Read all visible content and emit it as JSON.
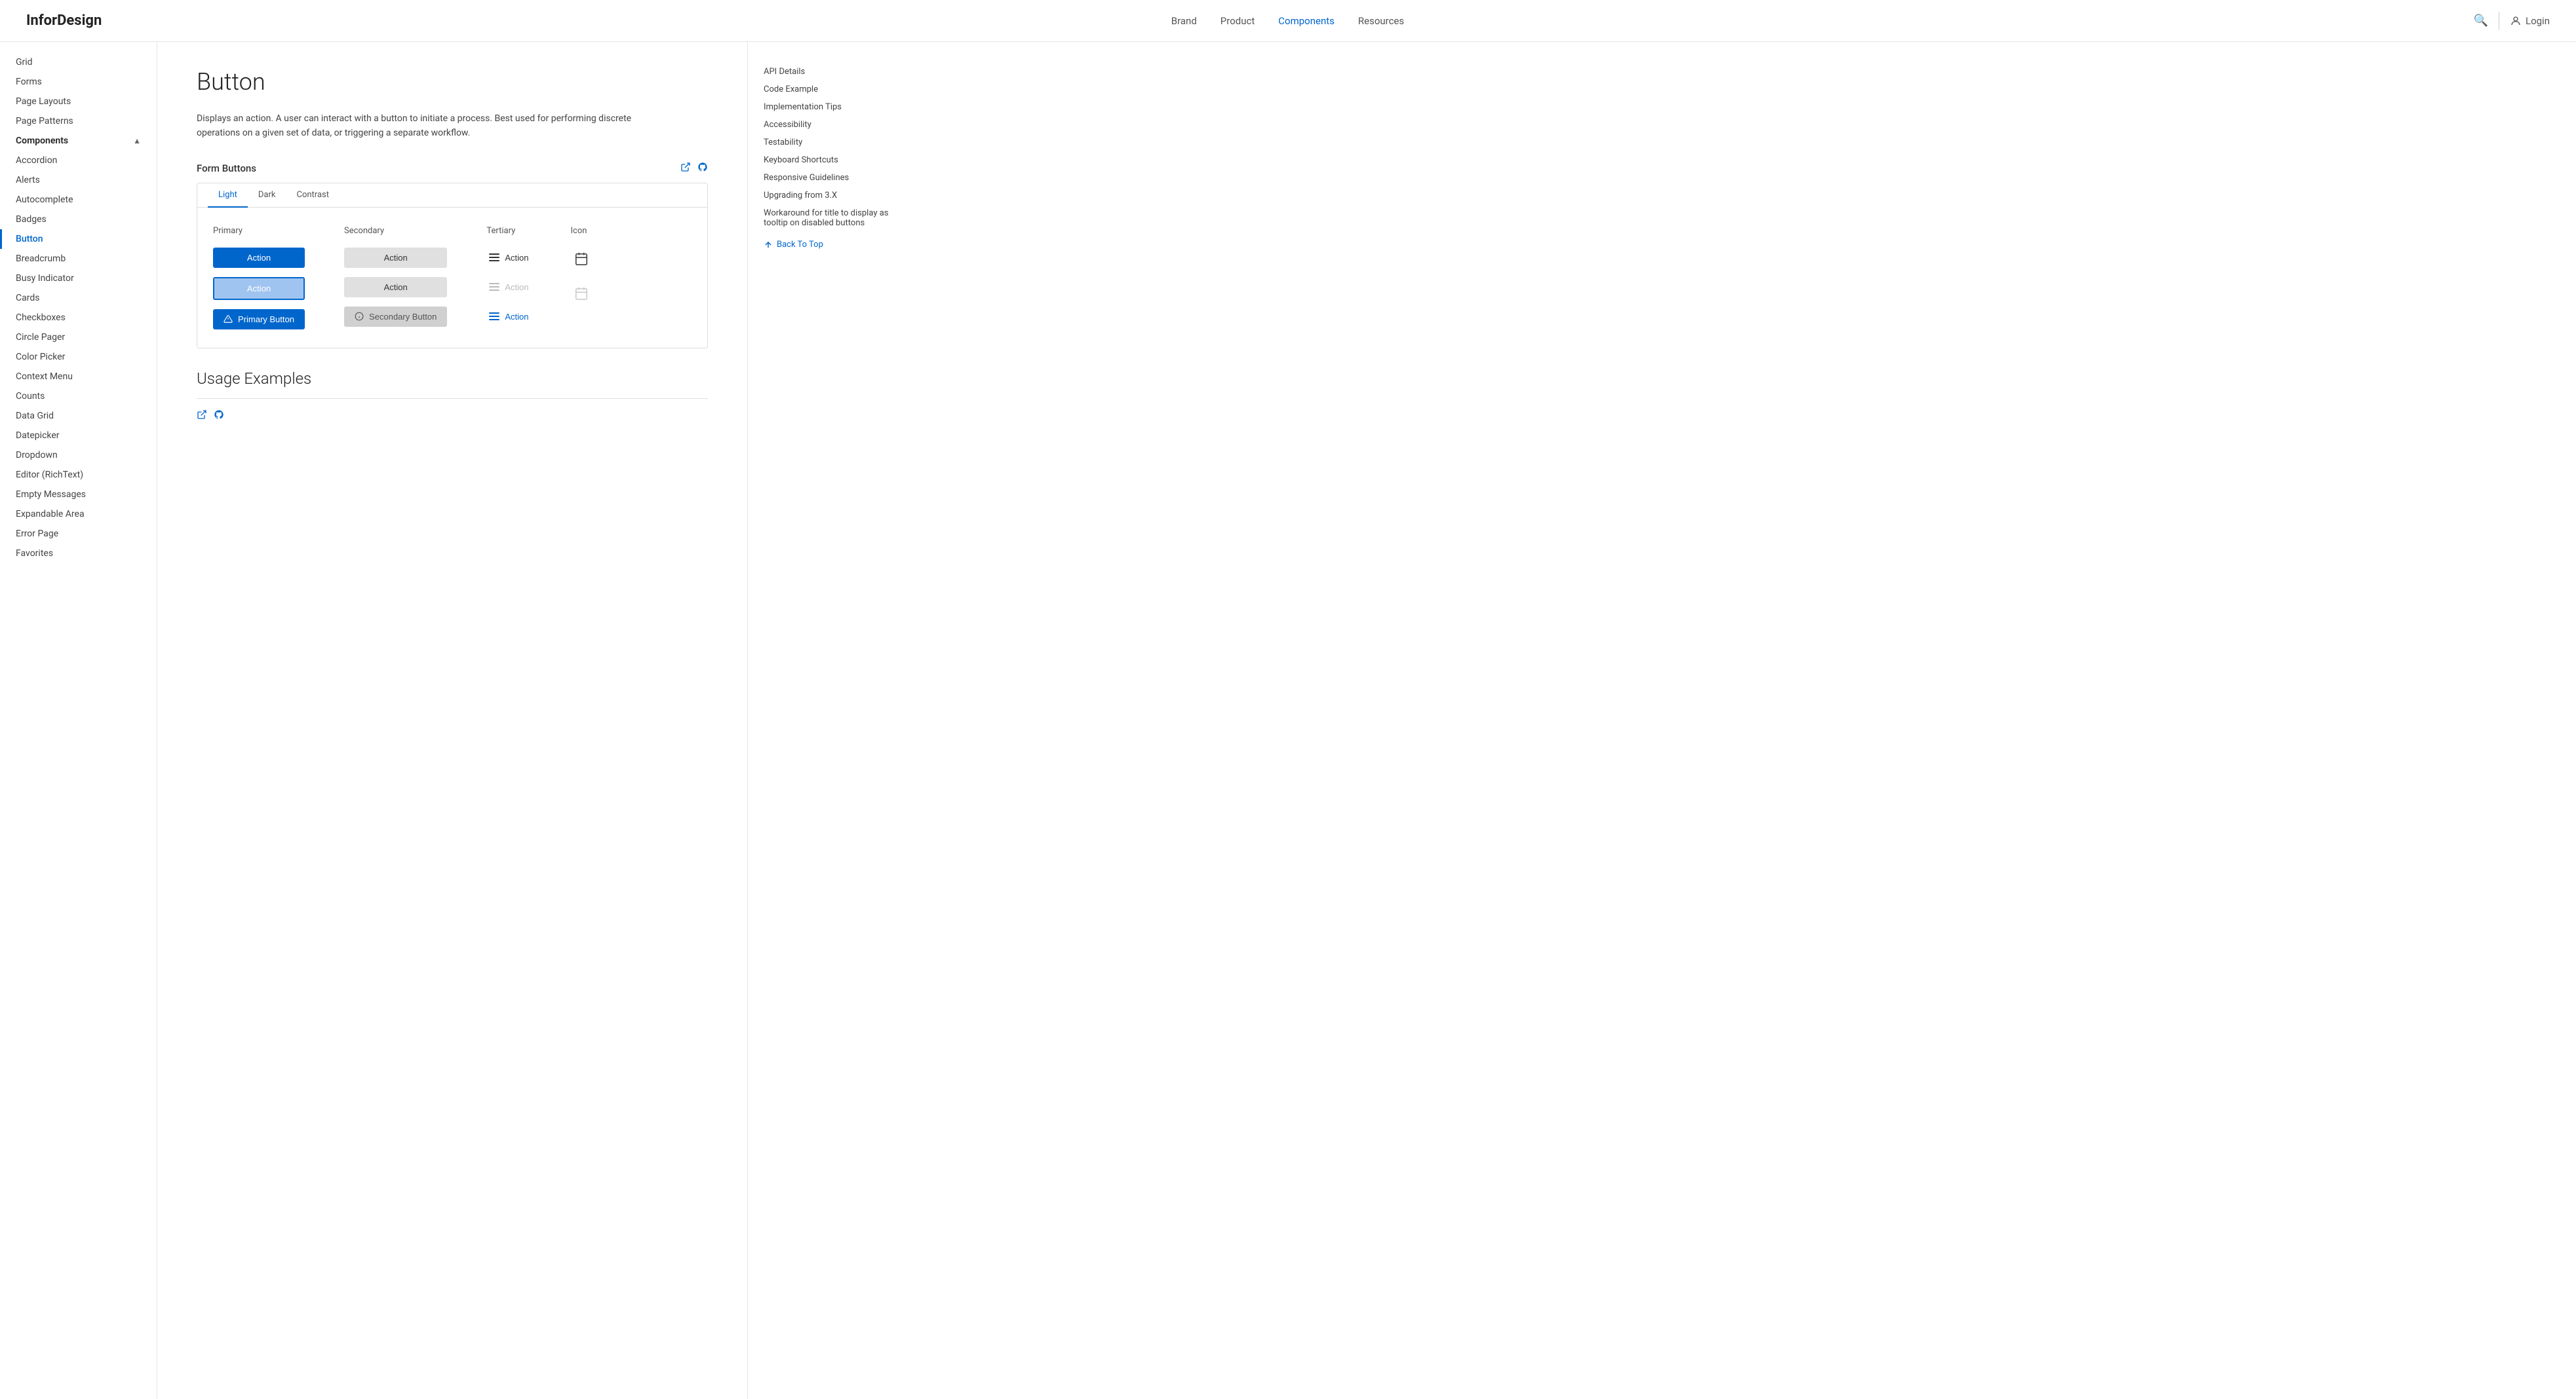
{
  "header": {
    "logo_text": "Infor",
    "logo_bold": "Design",
    "nav": [
      {
        "label": "Brand",
        "active": false
      },
      {
        "label": "Product",
        "active": false
      },
      {
        "label": "Components",
        "active": true
      },
      {
        "label": "Resources",
        "active": false
      }
    ],
    "login_label": "Login"
  },
  "sidebar": {
    "items_above": [
      {
        "label": "Grid"
      },
      {
        "label": "Forms"
      },
      {
        "label": "Page Layouts"
      },
      {
        "label": "Page Patterns"
      }
    ],
    "section_label": "Components",
    "components": [
      {
        "label": "Accordion",
        "active": false
      },
      {
        "label": "Alerts",
        "active": false
      },
      {
        "label": "Autocomplete",
        "active": false
      },
      {
        "label": "Badges",
        "active": false
      },
      {
        "label": "Button",
        "active": true
      },
      {
        "label": "Breadcrumb",
        "active": false
      },
      {
        "label": "Busy Indicator",
        "active": false
      },
      {
        "label": "Cards",
        "active": false
      },
      {
        "label": "Checkboxes",
        "active": false
      },
      {
        "label": "Circle Pager",
        "active": false
      },
      {
        "label": "Color Picker",
        "active": false
      },
      {
        "label": "Context Menu",
        "active": false
      },
      {
        "label": "Counts",
        "active": false
      },
      {
        "label": "Data Grid",
        "active": false
      },
      {
        "label": "Datepicker",
        "active": false
      },
      {
        "label": "Dropdown",
        "active": false
      },
      {
        "label": "Editor (RichText)",
        "active": false
      },
      {
        "label": "Empty Messages",
        "active": false
      },
      {
        "label": "Expandable Area",
        "active": false
      },
      {
        "label": "Error Page",
        "active": false
      },
      {
        "label": "Favorites",
        "active": false
      }
    ]
  },
  "main": {
    "page_title": "Button",
    "description": "Displays an action. A user can interact with a button to initiate a process. Best used for performing discrete operations on a given set of data, or triggering a separate workflow.",
    "form_buttons_section": {
      "title": "Form Buttons",
      "tabs": [
        "Light",
        "Dark",
        "Contrast"
      ],
      "active_tab": "Light",
      "columns": [
        {
          "label": "Primary",
          "buttons": [
            {
              "type": "primary",
              "label": "Action"
            },
            {
              "type": "primary-busy",
              "label": "Action"
            },
            {
              "type": "primary-icon",
              "label": "Primary Button",
              "icon": "warning"
            }
          ]
        },
        {
          "label": "Secondary",
          "buttons": [
            {
              "type": "secondary",
              "label": "Action"
            },
            {
              "type": "secondary",
              "label": "Action"
            },
            {
              "type": "secondary-icon",
              "label": "Secondary Button",
              "icon": "info"
            }
          ]
        },
        {
          "label": "Tertiary",
          "buttons": [
            {
              "type": "tertiary",
              "label": "Action",
              "icon": "hamburger"
            },
            {
              "type": "tertiary-disabled",
              "label": "Action",
              "icon": "hamburger"
            },
            {
              "type": "tertiary-active",
              "label": "Action",
              "icon": "hamburger"
            }
          ]
        },
        {
          "label": "Icon",
          "buttons": [
            {
              "type": "icon",
              "icon": "calendar"
            },
            {
              "type": "icon-disabled",
              "icon": "calendar"
            }
          ]
        }
      ]
    },
    "usage_title": "Usage Examples"
  },
  "toc": {
    "items": [
      "API Details",
      "Code Example",
      "Implementation Tips",
      "Accessibility",
      "Testability",
      "Keyboard Shortcuts",
      "Responsive Guidelines",
      "Upgrading from 3.X",
      "Workaround for title to display as tooltip on disabled buttons"
    ],
    "back_to_top": "Back To Top"
  }
}
